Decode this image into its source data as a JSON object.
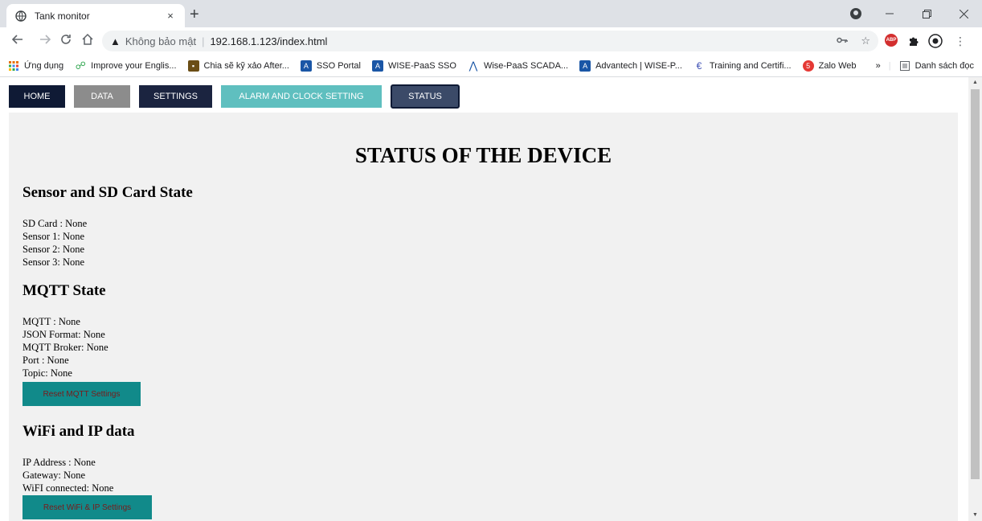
{
  "browser": {
    "tab_title": "Tank monitor",
    "tab_close": "×",
    "new_tab": "+",
    "omnibox": {
      "security_label": "Không bảo mật",
      "separator": "|",
      "url": "192.168.1.123/index.html"
    },
    "bookmarks": [
      {
        "label": "Ứng dụng",
        "icon": "apps-grid-icon",
        "color": "#e8710a"
      },
      {
        "label": "Improve your Englis...",
        "icon": "people-icon",
        "color": "#34a853"
      },
      {
        "label": "Chia sẽ kỹ xảo After...",
        "icon": "video-icon",
        "color": "#6b4e16"
      },
      {
        "label": "SSO Portal",
        "icon": "advantech-a-icon",
        "color": "#1a56a6"
      },
      {
        "label": "WISE-PaaS SSO",
        "icon": "advantech-a-icon",
        "color": "#1a56a6"
      },
      {
        "label": "Wise-PaaS SCADA...",
        "icon": "advantech-logo-icon",
        "color": "#1a56a6"
      },
      {
        "label": "Advantech | WISE-P...",
        "icon": "advantech-a-icon",
        "color": "#1a56a6"
      },
      {
        "label": "Training and Certifi...",
        "icon": "training-icon",
        "color": "#3f51b5"
      },
      {
        "label": "Zalo Web",
        "icon": "zalo-icon",
        "color": "#e53935"
      }
    ],
    "bookmarks_overflow": "»",
    "reading_list_label": "Danh sách đọc"
  },
  "nav": {
    "home": "HOME",
    "data": "DATA",
    "settings": "SETTINGS",
    "alarm": "ALARM AND CLOCK SETTING",
    "status": "STATUS"
  },
  "page": {
    "title": "STATUS OF THE DEVICE",
    "sensor_section": {
      "heading": "Sensor and SD Card State",
      "lines": [
        "SD Card : None",
        "Sensor 1: None",
        "Sensor 2: None",
        "Sensor 3: None"
      ]
    },
    "mqtt_section": {
      "heading": "MQTT State",
      "lines": [
        "MQTT : None",
        "JSON Format: None",
        "MQTT Broker: None",
        "Port : None",
        "Topic: None"
      ],
      "reset_button": "Reset MQTT Settings"
    },
    "wifi_section": {
      "heading": "WiFi and IP data",
      "lines": [
        "IP Address : None",
        "Gateway: None",
        "WiFI connected: None"
      ],
      "reset_button": "Reset WiFi & IP Settings"
    }
  },
  "colors": {
    "nav_home": "#0f1a35",
    "nav_data": "#8c8c8c",
    "nav_settings": "#1b2440",
    "nav_alarm": "#5fbfbf",
    "nav_status": "#3b4a68",
    "reset_button_bg": "#118a8a",
    "reset_button_text": "#7a1a1a",
    "panel_bg": "#f1f1f1"
  }
}
